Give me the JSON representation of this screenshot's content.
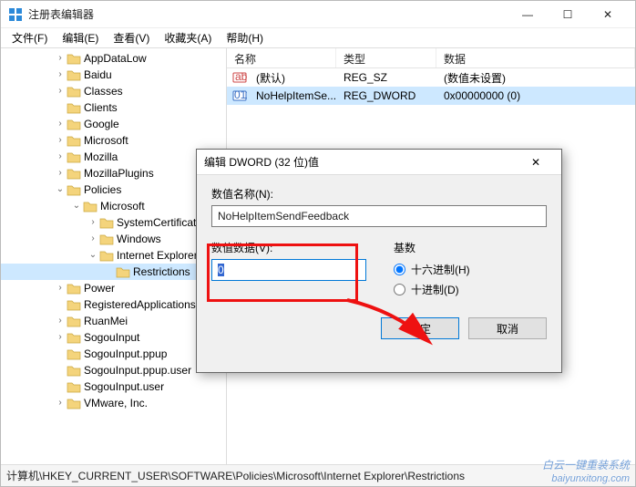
{
  "window": {
    "title": "注册表编辑器"
  },
  "menu": {
    "file": "文件(F)",
    "edit": "编辑(E)",
    "view": "查看(V)",
    "favorites": "收藏夹(A)",
    "help": "帮助(H)"
  },
  "tree": [
    {
      "label": "AppDataLow",
      "level": 3,
      "twisty": ">"
    },
    {
      "label": "Baidu",
      "level": 3,
      "twisty": ">"
    },
    {
      "label": "Classes",
      "level": 3,
      "twisty": ">"
    },
    {
      "label": "Clients",
      "level": 3,
      "twisty": ""
    },
    {
      "label": "Google",
      "level": 3,
      "twisty": ">"
    },
    {
      "label": "Microsoft",
      "level": 3,
      "twisty": ">"
    },
    {
      "label": "Mozilla",
      "level": 3,
      "twisty": ">"
    },
    {
      "label": "MozillaPlugins",
      "level": 3,
      "twisty": ">"
    },
    {
      "label": "Policies",
      "level": 3,
      "twisty": "v"
    },
    {
      "label": "Microsoft",
      "level": 4,
      "twisty": "v"
    },
    {
      "label": "SystemCertificates",
      "level": 5,
      "twisty": ">"
    },
    {
      "label": "Windows",
      "level": 5,
      "twisty": ">"
    },
    {
      "label": "Internet Explorer",
      "level": 5,
      "twisty": "v"
    },
    {
      "label": "Restrictions",
      "level": 6,
      "twisty": "",
      "selected": true
    },
    {
      "label": "Power",
      "level": 3,
      "twisty": ">"
    },
    {
      "label": "RegisteredApplications",
      "level": 3,
      "twisty": ""
    },
    {
      "label": "RuanMei",
      "level": 3,
      "twisty": ">"
    },
    {
      "label": "SogouInput",
      "level": 3,
      "twisty": ">"
    },
    {
      "label": "SogouInput.ppup",
      "level": 3,
      "twisty": ""
    },
    {
      "label": "SogouInput.ppup.user",
      "level": 3,
      "twisty": ""
    },
    {
      "label": "SogouInput.user",
      "level": 3,
      "twisty": ""
    },
    {
      "label": "VMware, Inc.",
      "level": 3,
      "twisty": ">"
    }
  ],
  "list": {
    "columns": {
      "name": "名称",
      "type": "类型",
      "data": "数据"
    },
    "rows": [
      {
        "icon": "ab",
        "name": "(默认)",
        "type": "REG_SZ",
        "data": "(数值未设置)",
        "selected": false
      },
      {
        "icon": "010",
        "name": "NoHelpItemSe...",
        "type": "REG_DWORD",
        "data": "0x00000000 (0)",
        "selected": true
      }
    ]
  },
  "statusbar": {
    "path": "计算机\\HKEY_CURRENT_USER\\SOFTWARE\\Policies\\Microsoft\\Internet Explorer\\Restrictions"
  },
  "dialog": {
    "title": "编辑 DWORD (32 位)值",
    "name_label": "数值名称(N):",
    "name_value": "NoHelpItemSendFeedback",
    "data_label": "数值数据(V):",
    "data_value": "0",
    "base_label": "基数",
    "radio_hex": "十六进制(H)",
    "radio_dec": "十进制(D)",
    "ok": "确定",
    "cancel": "取消"
  },
  "watermark": {
    "line1": "白云一键重装系统",
    "line2": "baiyunxitong.com"
  }
}
